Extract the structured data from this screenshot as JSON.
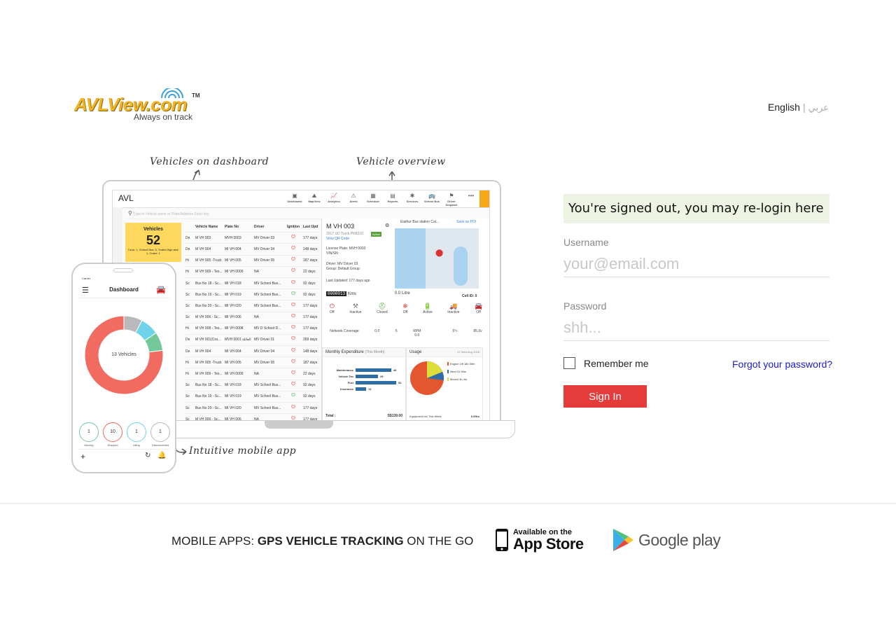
{
  "header": {
    "logo_text": "AVLView.com",
    "logo_tm": "TM",
    "logo_tagline": "Always on track",
    "lang_english": "English",
    "lang_separator": "|",
    "lang_arabic": "عربي"
  },
  "illustration": {
    "callout_dashboard": "Vehicles on dashboard",
    "callout_overview": "Vehicle overview",
    "callout_mobile": "Intuitive mobile app",
    "app_title": "AVL",
    "nav": [
      "Dashboard",
      "MapView",
      "Analytics",
      "Alerts",
      "Schedule",
      "Reports",
      "Services",
      "School Bus",
      "Driver Dispatch"
    ],
    "search_placeholder": "Type in Vehicle name or Plate/Address Enter key",
    "vehicles_card": {
      "title": "Vehicles",
      "count": "52",
      "note": "Truck: 1, School Bus: 6, Trailer-High bed: 1, Crane: 1"
    },
    "table_headers": [
      "Vehicle Name",
      "Plate No",
      "Driver",
      "Ignition",
      "Last Upd"
    ],
    "rows": [
      {
        "t": "De",
        "name": "M VH 003",
        "plate": "MVH 0003",
        "driver": "MV Driver 03",
        "on": false,
        "last": "177 days"
      },
      {
        "t": "De",
        "name": "M VH 004",
        "plate": "MI VH 004",
        "driver": "MV Driver 04",
        "on": false,
        "last": "148 days"
      },
      {
        "t": "Hi",
        "name": "M VH 005 -Truck",
        "plate": "MI VH 005",
        "driver": "MV Driver 05",
        "on": false,
        "last": "187 days"
      },
      {
        "t": "Hi",
        "name": "M VH 009 - Tes...",
        "plate": "MI VH 0009",
        "driver": "NA",
        "on": false,
        "last": "22 days"
      },
      {
        "t": "Sc",
        "name": "Bus No 18 - Sc...",
        "plate": "MI VH 018",
        "driver": "MV School Bus...",
        "on": false,
        "last": "92 days"
      },
      {
        "t": "Sc",
        "name": "Bus No 19 - Sc...",
        "plate": "MI VH 019",
        "driver": "MV School Bus...",
        "on": true,
        "last": "92 days"
      },
      {
        "t": "Sc",
        "name": "Bus No 20 - Sc...",
        "plate": "MI VH 020",
        "driver": "MV School Bus...",
        "on": false,
        "last": "177 days"
      },
      {
        "t": "Sc",
        "name": "M VH 006 - Sc...",
        "plate": "MI VH 006",
        "driver": "NA",
        "on": false,
        "last": "177 days"
      },
      {
        "t": "Hi",
        "name": "M VH 008 - Tes...",
        "plate": "MI VH 0008",
        "driver": "MV D School D...",
        "on": false,
        "last": "177 days"
      },
      {
        "t": "De",
        "name": "M VH 001(Cra...",
        "plate": "MVH 0001 العائلة",
        "driver": "MV Driver 01",
        "on": false,
        "last": "269 days"
      },
      {
        "t": "De",
        "name": "M VH 004",
        "plate": "MI VH 004",
        "driver": "MV Driver 04",
        "on": false,
        "last": "148 days"
      },
      {
        "t": "Hi",
        "name": "M VH 005 -Truck",
        "plate": "MI VH 005",
        "driver": "MV Driver 05",
        "on": false,
        "last": "187 days"
      },
      {
        "t": "Hi",
        "name": "M VH 009 - Tes...",
        "plate": "MI VH 0009",
        "driver": "NA",
        "on": false,
        "last": "22 days"
      },
      {
        "t": "Sc",
        "name": "Bus No 18 - Sc...",
        "plate": "MI VH 018",
        "driver": "MV School Bus...",
        "on": false,
        "last": "92 days"
      },
      {
        "t": "Sc",
        "name": "Bus No 19 - Sc...",
        "plate": "MI VH 019",
        "driver": "MV School Bus...",
        "on": true,
        "last": "92 days"
      },
      {
        "t": "Sc",
        "name": "Bus No 20 - Sc...",
        "plate": "MI VH 020",
        "driver": "MV School Bus...",
        "on": false,
        "last": "177 days"
      },
      {
        "t": "Sc",
        "name": "M VH 006 - Sc...",
        "plate": "MI VH 006",
        "driver": "NA",
        "on": false,
        "last": "177 days"
      }
    ],
    "detail": {
      "title": "M VH 003",
      "subtitle": "2017 UD Truck PKB210",
      "badge": "Active",
      "qr": "View QR Code",
      "plate": "License Plate: MVH 0003",
      "vin": "VIN/SN:",
      "driver": "Driver: MV Driver 03",
      "group": "Group: Default Group",
      "updated": "Last Updated: 177 days ago",
      "map_caption": "Elathur Bus station Cal...",
      "save": "Save as POI",
      "odometer": "0000013",
      "odometer_unit": "Kms",
      "fuel": "0.0 Litre",
      "cell": "Cell ID: 0",
      "statuses": [
        "Off",
        "Inactive",
        "Closed",
        "Off",
        "Active",
        "Inactive",
        "Off"
      ],
      "metrics": [
        {
          "label": "Network Coverage",
          "value": ""
        },
        {
          "label": "",
          "value": "0.0"
        },
        {
          "label": "",
          "value": "5"
        },
        {
          "label": "RPM",
          "value": "0.0"
        },
        {
          "label": "",
          "value": ""
        },
        {
          "label": "",
          "value": "5°c"
        },
        {
          "label": "",
          "value": "85.0v"
        }
      ],
      "expenditure_title": "Monthly Expenditure",
      "expenditure_period": "(This Month)",
      "expenditure_total_label": "Total :",
      "expenditure_total": "S$139.00",
      "usage_title": "Usage",
      "usage_date": "22 Wed Aug 2018",
      "usage_footer": "Equipment hrs This Week",
      "usage_footer_val": "0.0Hrs",
      "usage_legend": [
        "Engine Off 18h 59m",
        "Idled 1h 56m",
        "Moved 3h 4m"
      ]
    },
    "expenditure": [
      {
        "label": "Maintenance",
        "value": 46
      },
      {
        "label": "Vehicle Tax",
        "value": 29
      },
      {
        "label": "Fuel",
        "value": 52
      },
      {
        "label": "Insurance",
        "value": 13
      }
    ],
    "phone": {
      "carrier": "Carrier",
      "title": "Dashboard",
      "donut_center": "13 Vehicles",
      "donut_segments": [
        {
          "name": "Stopped",
          "value": 10,
          "color": "#f26b61"
        },
        {
          "name": "Disconnected",
          "value": 1,
          "color": "#b9b9b9"
        },
        {
          "name": "Idling",
          "value": 1,
          "color": "#6fd3ea"
        },
        {
          "name": "Moving",
          "value": 1,
          "color": "#73c99a"
        }
      ],
      "counts": [
        {
          "label": "Moving",
          "value": "1",
          "color": "#73c99a"
        },
        {
          "label": "Stopped",
          "value": "10",
          "color": "#f26b61"
        },
        {
          "label": "Idling",
          "value": "1",
          "color": "#6fd3ea"
        },
        {
          "label": "Disconnected",
          "value": "1",
          "color": "#b9b9b9"
        }
      ]
    }
  },
  "login": {
    "signed_out_message": "You're signed out, you may re-login here",
    "username_label": "Username",
    "username_placeholder": "your@email.com",
    "password_label": "Password",
    "password_placeholder": "shh...",
    "remember_label": "Remember me",
    "forgot_label": "Forgot your password?",
    "signin_label": "Sign In"
  },
  "footer": {
    "tagline_prefix": "MOBILE APPS: ",
    "tagline_bold": "GPS VEHICLE TRACKING",
    "tagline_suffix": " ON THE GO",
    "appstore_small": "Available on the",
    "appstore_big": "App Store",
    "googleplay": "Google play"
  },
  "colors": {
    "brand": "#f2b324",
    "signin": "#e53b3b",
    "signed_out_bg": "#eef4e3",
    "link": "#1a1ad6"
  }
}
